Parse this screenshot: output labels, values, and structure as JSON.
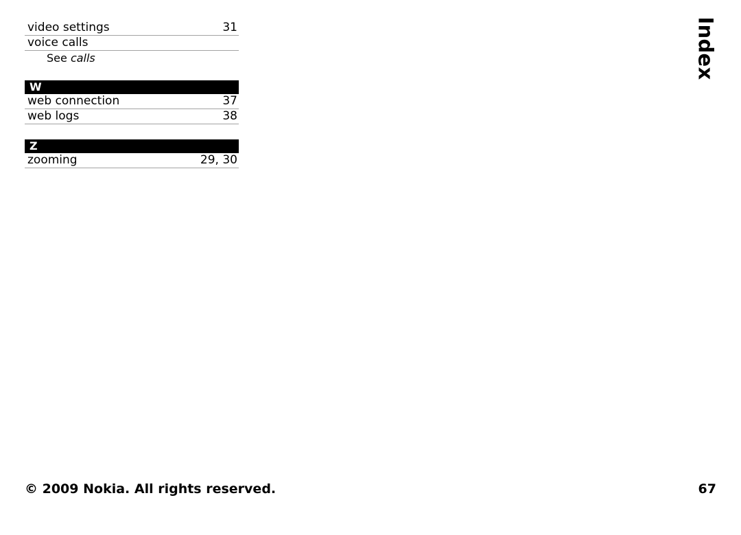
{
  "page": {
    "side_tab_label": "Index",
    "page_number": "67",
    "copyright": "© 2009 Nokia. All rights reserved."
  },
  "index": {
    "sections": [
      {
        "letter": "",
        "entries": [
          {
            "term": "video settings",
            "pages": "31"
          },
          {
            "term": "voice calls",
            "pages": ""
          }
        ],
        "xref": {
          "see_label": "See",
          "target": "calls"
        }
      },
      {
        "letter": "W",
        "entries": [
          {
            "term": "web connection",
            "pages": "37"
          },
          {
            "term": "web logs",
            "pages": "38"
          }
        ]
      },
      {
        "letter": "Z",
        "entries": [
          {
            "term": "zooming",
            "pages": "29, 30"
          }
        ]
      }
    ]
  }
}
